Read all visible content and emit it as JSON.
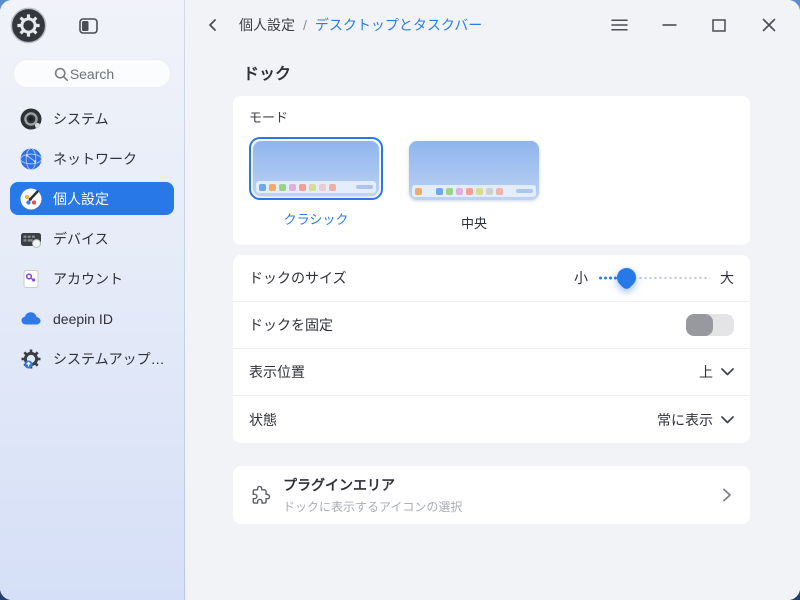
{
  "window": {
    "search_placeholder": "Search"
  },
  "sidebar": {
    "items": [
      {
        "label": "システム",
        "icon": "system-icon",
        "active": false
      },
      {
        "label": "ネットワーク",
        "icon": "network-icon",
        "active": false
      },
      {
        "label": "個人設定",
        "icon": "personalization-icon",
        "active": true
      },
      {
        "label": "デバイス",
        "icon": "devices-icon",
        "active": false
      },
      {
        "label": "アカウント",
        "icon": "accounts-icon",
        "active": false
      },
      {
        "label": "deepin ID",
        "icon": "cloud-icon",
        "active": false
      },
      {
        "label": "システムアップ…",
        "icon": "update-icon",
        "active": false
      }
    ]
  },
  "header": {
    "breadcrumb_parent": "個人設定",
    "breadcrumb_separator": "/",
    "breadcrumb_current": "デスクトップとタスクバー"
  },
  "page": {
    "title": "ドック",
    "mode_section": {
      "label": "モード",
      "options": [
        {
          "label": "クラシック",
          "selected": true,
          "dock": {
            "align": "left",
            "leading": [],
            "icons": [
              "#6fa7ea",
              "#f0ab68",
              "#9bd489",
              "#dfb0df",
              "#f59e91",
              "#d6de8d",
              "#e9cbd0",
              "#f0aea7"
            ],
            "pill": "#aec4ea"
          }
        },
        {
          "label": "中央",
          "selected": false,
          "dock": {
            "align": "center",
            "leading": [
              "#f0ab68"
            ],
            "icons": [
              "#6fa7ea",
              "#9bd489",
              "#dfb0df",
              "#f59e91",
              "#d6de8d",
              "#cfd0d2",
              "#f0b3ad"
            ],
            "pill": "#aec4ea"
          }
        }
      ]
    },
    "settings": {
      "dock_size": {
        "label": "ドックのサイズ",
        "min_label": "小",
        "max_label": "大",
        "value_percent": 25
      },
      "dock_fixed": {
        "label": "ドックを固定",
        "state": "off"
      },
      "position": {
        "label": "表示位置",
        "value": "上"
      },
      "status": {
        "label": "状態",
        "value": "常に表示"
      }
    },
    "plugin_area": {
      "title": "プラグインエリア",
      "subtitle": "ドックに表示するアイコンの選択"
    }
  },
  "colors": {
    "accent": "#2878e8",
    "link": "#2b7de9",
    "toggle_off_knob": "#97999e",
    "card_bg": "#ffffff"
  }
}
